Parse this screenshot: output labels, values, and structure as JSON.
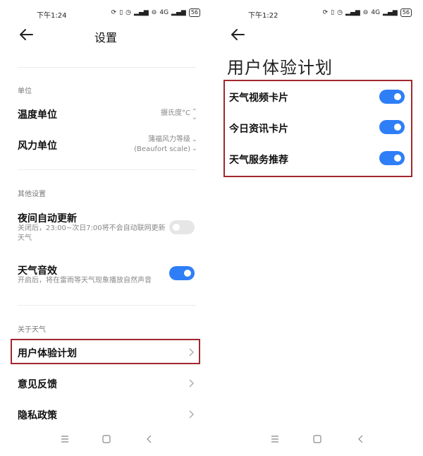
{
  "left": {
    "status": {
      "time": "下午1:24",
      "network": "4G",
      "battery": "56"
    },
    "header": {
      "title": "设置"
    },
    "section_units": {
      "label": "单位",
      "temperature": {
        "label": "温度单位",
        "value": "摄氏度°C"
      },
      "wind": {
        "label": "风力单位",
        "value_line1": "蒲福风力等级",
        "value_line2": "(Beaufort scale)"
      }
    },
    "section_other": {
      "label": "其他设置",
      "night_update": {
        "label": "夜间自动更新",
        "desc": "关闭后，23:00~次日7:00将不会自动联网更新天气",
        "enabled": false
      },
      "sound": {
        "label": "天气音效",
        "desc": "开启后，将在雷雨等天气现象播放自然声音",
        "enabled": true
      }
    },
    "section_about": {
      "label": "关于天气",
      "items": [
        "用户体验计划",
        "意见反馈",
        "隐私政策"
      ]
    }
  },
  "right": {
    "status": {
      "time": "下午1:22",
      "network": "4G",
      "battery": "56"
    },
    "title": "用户体验计划",
    "toggles": [
      {
        "label": "天气视频卡片",
        "enabled": true
      },
      {
        "label": "今日资讯卡片",
        "enabled": true
      },
      {
        "label": "天气服务推荐",
        "enabled": true
      }
    ]
  },
  "colors": {
    "accent": "#2e7ef7",
    "highlight": "#a1272e",
    "toggle_off": "#e6e6e6"
  },
  "icons": [
    "back-arrow-icon",
    "chevron-right-icon",
    "updown-icon",
    "menu-icon",
    "home-icon",
    "back-nav-icon",
    "wifi-icon",
    "signal-icon",
    "battery-icon"
  ]
}
